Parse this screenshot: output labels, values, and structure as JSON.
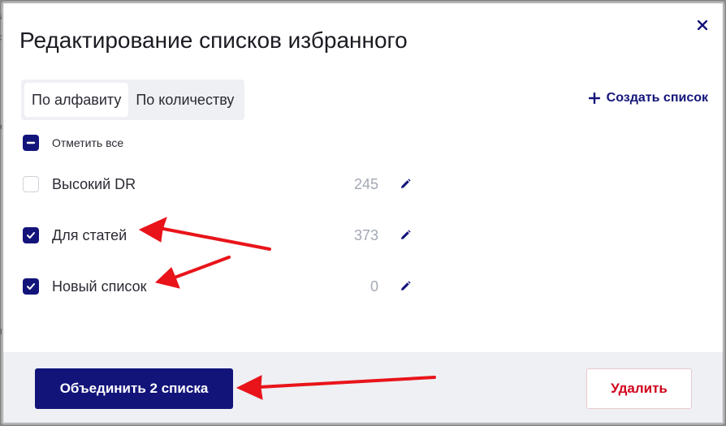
{
  "backdrop": {
    "fragments": [
      "а",
      "э",
      "е",
      "ии"
    ]
  },
  "modal": {
    "title": "Редактирование списков избранного",
    "sort_tabs": [
      {
        "label": "По алфавиту",
        "active": true
      },
      {
        "label": "По количеству",
        "active": false
      }
    ],
    "create_list_label": "Создать список",
    "check_all_label": "Отметить все",
    "lists": [
      {
        "label": "Высокий DR",
        "count": "245",
        "checked": false
      },
      {
        "label": "Для статей",
        "count": "373",
        "checked": true
      },
      {
        "label": "Новый список",
        "count": "0",
        "checked": true
      }
    ],
    "footer": {
      "merge_label": "Объединить 2 списка",
      "delete_label": "Удалить"
    }
  },
  "colors": {
    "accent": "#13147a",
    "danger": "#d0021b",
    "annotation_arrow": "#e8141a",
    "footer_bg": "#eef0f3"
  }
}
